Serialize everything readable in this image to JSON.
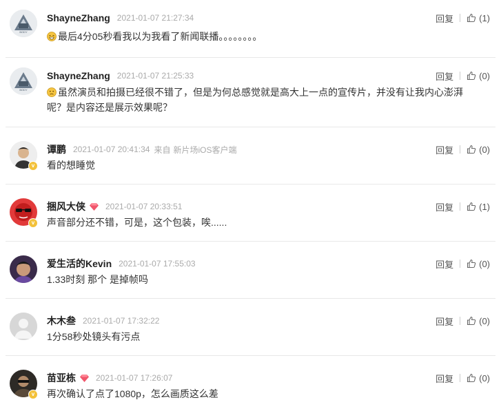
{
  "ui": {
    "reply_label": "回复"
  },
  "comments": [
    {
      "username": "ShayneZhang",
      "time": "2021-01-07 21:27:34",
      "text": "最后4分05秒看我以为我看了新闻联播。。。。。。。。",
      "likes": "(1)"
    },
    {
      "username": "ShayneZhang",
      "time": "2021-01-07 21:25:33",
      "text": "虽然演员和拍摄已经很不错了，但是为何总感觉就是高大上一点的宣传片，并没有让我内心澎湃呢？是内容还是展示效果呢？",
      "likes": "(0)"
    },
    {
      "username": "谭鹏",
      "time": "2021-01-07 20:41:34",
      "source": "来自",
      "source_client": "新片场iOS客户端",
      "text": "看的想睡觉",
      "likes": "(0)"
    },
    {
      "username": "捆风大侠",
      "time": "2021-01-07 20:33:51",
      "text": "声音部分还不错，可是，这个包装，唉......",
      "likes": "(1)"
    },
    {
      "username": "爱生活的Kevin",
      "time": "2021-01-07 17:55:03",
      "text": "1.33时刻 那个 是掉帧吗",
      "likes": "(0)"
    },
    {
      "username": "木木叁",
      "time": "2021-01-07 17:32:22",
      "text": "1分58秒处镜头有污点",
      "likes": "(0)"
    },
    {
      "username": "苗亚栋",
      "time": "2021-01-07 17:26:07",
      "text": "再次确认了点了1080p，怎么画质这么差",
      "likes": "(0)"
    }
  ]
}
